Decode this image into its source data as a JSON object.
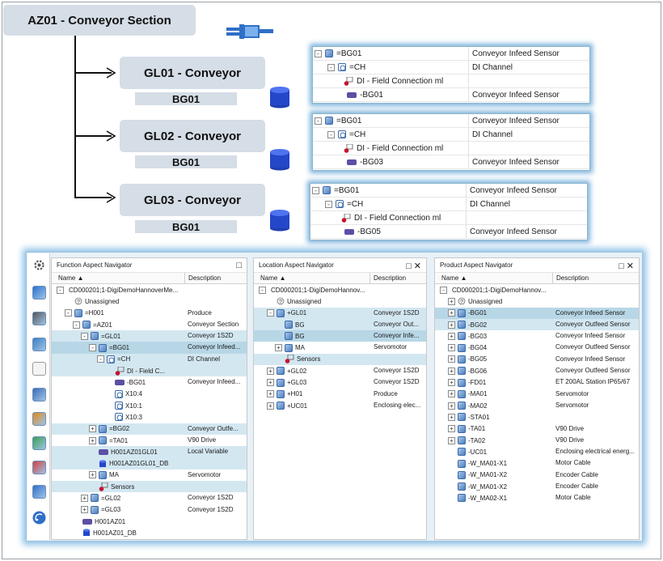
{
  "diagram": {
    "root_label": "AZ01 - Conveyor Section",
    "groups": [
      {
        "label": "GL01 - Conveyor",
        "sub": "BG01",
        "tree": [
          {
            "name": "=BG01",
            "desc": "Conveyor Infeed Sensor"
          },
          {
            "name": "=CH",
            "desc": "DI Channel"
          },
          {
            "name": "DI - Field Connection ml",
            "desc": ""
          },
          {
            "name": "-BG01",
            "desc": "Conveyor Infeed Sensor"
          }
        ]
      },
      {
        "label": "GL02 - Conveyor",
        "sub": "BG01",
        "tree": [
          {
            "name": "=BG01",
            "desc": "Conveyor Infeed Sensor"
          },
          {
            "name": "=CH",
            "desc": "DI Channel"
          },
          {
            "name": "DI - Field Connection ml",
            "desc": ""
          },
          {
            "name": "-BG03",
            "desc": "Conveyor Infeed Sensor"
          }
        ]
      },
      {
        "label": "GL03 - Conveyor",
        "sub": "BG01",
        "tree": [
          {
            "name": "=BG01",
            "desc": "Conveyor Infeed Sensor"
          },
          {
            "name": "=CH",
            "desc": "DI Channel"
          },
          {
            "name": "DI - Field Connection ml",
            "desc": ""
          },
          {
            "name": "-BG05",
            "desc": "Conveyor Infeed Sensor"
          }
        ]
      }
    ]
  },
  "function_nav": {
    "title": "Function Aspect Navigator",
    "col_name": "Name",
    "col_desc": "Description",
    "rows": [
      {
        "t": "CD000201;1-DigiDemoHannoverMe...",
        "d": "",
        "lvl": 0,
        "exp": "-",
        "ic": ""
      },
      {
        "t": "Unassigned",
        "d": "",
        "lvl": 1,
        "exp": "",
        "ic": "un"
      },
      {
        "t": "=H001",
        "d": "Produce",
        "lvl": 1,
        "exp": "-",
        "ic": "cube"
      },
      {
        "t": "=AZ01",
        "d": "Conveyor Section",
        "lvl": 2,
        "exp": "-",
        "ic": "cube"
      },
      {
        "t": "=GL01",
        "d": "Conveyor 1S2D",
        "lvl": 3,
        "exp": "-",
        "ic": "cube",
        "sel": 1
      },
      {
        "t": "=BG01",
        "d": "Conveyor Infeed...",
        "lvl": 4,
        "exp": "-",
        "ic": "cube",
        "sel": 2
      },
      {
        "t": "=CH",
        "d": "DI Channel",
        "lvl": 5,
        "exp": "-",
        "ic": "chn",
        "sel": 1
      },
      {
        "t": "DI - Field C...",
        "d": "",
        "lvl": 6,
        "exp": "",
        "ic": "sensor",
        "sel": 1
      },
      {
        "t": "-BG01",
        "d": "Conveyor Infeed...",
        "lvl": 6,
        "exp": "",
        "ic": "tag"
      },
      {
        "t": "X10:4",
        "d": "",
        "lvl": 6,
        "exp": "",
        "ic": "chn"
      },
      {
        "t": "X10:1",
        "d": "",
        "lvl": 6,
        "exp": "",
        "ic": "chn"
      },
      {
        "t": "X10:3",
        "d": "",
        "lvl": 6,
        "exp": "",
        "ic": "chn"
      },
      {
        "t": "=BG02",
        "d": "Conveyor Outfe...",
        "lvl": 4,
        "exp": "+",
        "ic": "cube",
        "sel": 1
      },
      {
        "t": "=TA01",
        "d": "V90 Drive",
        "lvl": 4,
        "exp": "+",
        "ic": "cube"
      },
      {
        "t": "H001AZ01GL01",
        "d": "Local Variable",
        "lvl": 4,
        "exp": "",
        "ic": "tag",
        "sel": 1
      },
      {
        "t": "H001AZ01GL01_DB",
        "d": "",
        "lvl": 4,
        "exp": "",
        "ic": "db",
        "sel": 1
      },
      {
        "t": "MA",
        "d": "Servomotor",
        "lvl": 4,
        "exp": "+",
        "ic": "cube"
      },
      {
        "t": "Sensors",
        "d": "",
        "lvl": 4,
        "exp": "",
        "ic": "sensor",
        "sel": 1
      },
      {
        "t": "=GL02",
        "d": "Conveyor 1S2D",
        "lvl": 3,
        "exp": "+",
        "ic": "cube"
      },
      {
        "t": "=GL03",
        "d": "Conveyor 1S2D",
        "lvl": 3,
        "exp": "+",
        "ic": "cube"
      },
      {
        "t": "H001AZ01",
        "d": "",
        "lvl": 2,
        "exp": "",
        "ic": "tag"
      },
      {
        "t": "H001AZ01_DB",
        "d": "",
        "lvl": 2,
        "exp": "",
        "ic": "db"
      }
    ]
  },
  "location_nav": {
    "title": "Location Aspect Navigator",
    "col_name": "Name",
    "col_desc": "Description",
    "rows": [
      {
        "t": "CD000201;1-DigiDemoHannov...",
        "d": "",
        "lvl": 0,
        "exp": "-",
        "ic": ""
      },
      {
        "t": "Unassigned",
        "d": "",
        "lvl": 1,
        "exp": "",
        "ic": "un"
      },
      {
        "t": "+GL01",
        "d": "Conveyor 1S2D",
        "lvl": 1,
        "exp": "-",
        "ic": "cube",
        "sel": 1
      },
      {
        "t": "BG",
        "d": "Conveyor Out...",
        "lvl": 2,
        "exp": "",
        "ic": "cube",
        "sel": 1
      },
      {
        "t": "BG",
        "d": "Conveyor Infe...",
        "lvl": 2,
        "exp": "",
        "ic": "cube",
        "sel": 2
      },
      {
        "t": "MA",
        "d": "Servomotor",
        "lvl": 2,
        "exp": "+",
        "ic": "cube"
      },
      {
        "t": "Sensors",
        "d": "",
        "lvl": 2,
        "exp": "",
        "ic": "sensor",
        "sel": 1
      },
      {
        "t": "+GL02",
        "d": "Conveyor 1S2D",
        "lvl": 1,
        "exp": "+",
        "ic": "cube"
      },
      {
        "t": "+GL03",
        "d": "Conveyor 1S2D",
        "lvl": 1,
        "exp": "+",
        "ic": "cube"
      },
      {
        "t": "+H01",
        "d": "Produce",
        "lvl": 1,
        "exp": "+",
        "ic": "cube"
      },
      {
        "t": "+UC01",
        "d": "Enclosing elec...",
        "lvl": 1,
        "exp": "+",
        "ic": "cube"
      }
    ]
  },
  "product_nav": {
    "title": "Product Aspect Navigator",
    "col_name": "Name",
    "col_desc": "Description",
    "rows": [
      {
        "t": "CD000201;1-DigiDemoHannov...",
        "d": "",
        "lvl": 0,
        "exp": "-",
        "ic": ""
      },
      {
        "t": "Unassigned",
        "d": "",
        "lvl": 1,
        "exp": "+",
        "ic": "un"
      },
      {
        "t": "-BG01",
        "d": "Conveyor Infeed Sensor",
        "lvl": 1,
        "exp": "+",
        "ic": "cube",
        "sel": 2
      },
      {
        "t": "-BG02",
        "d": "Conveyor Outfeed Sensor",
        "lvl": 1,
        "exp": "+",
        "ic": "cube",
        "sel": 1
      },
      {
        "t": "-BG03",
        "d": "Conveyor Infeed Sensor",
        "lvl": 1,
        "exp": "+",
        "ic": "cube"
      },
      {
        "t": "-BG04",
        "d": "Conveyor Outfeed Sensor",
        "lvl": 1,
        "exp": "+",
        "ic": "cube"
      },
      {
        "t": "-BG05",
        "d": "Conveyor Infeed Sensor",
        "lvl": 1,
        "exp": "+",
        "ic": "cube"
      },
      {
        "t": "-BG06",
        "d": "Conveyor Outfeed Sensor",
        "lvl": 1,
        "exp": "+",
        "ic": "cube"
      },
      {
        "t": "-FD01",
        "d": "ET 200AL Station IP65/67",
        "lvl": 1,
        "exp": "+",
        "ic": "cube"
      },
      {
        "t": "-MA01",
        "d": "Servomotor",
        "lvl": 1,
        "exp": "+",
        "ic": "cube"
      },
      {
        "t": "-MA02",
        "d": "Servomotor",
        "lvl": 1,
        "exp": "+",
        "ic": "cube"
      },
      {
        "t": "-STA01",
        "d": "",
        "lvl": 1,
        "exp": "+",
        "ic": "cube"
      },
      {
        "t": "-TA01",
        "d": "V90 Drive",
        "lvl": 1,
        "exp": "+",
        "ic": "cube"
      },
      {
        "t": "-TA02",
        "d": "V90 Drive",
        "lvl": 1,
        "exp": "+",
        "ic": "cube"
      },
      {
        "t": "-UC01",
        "d": "Enclosing electrical energ...",
        "lvl": 1,
        "exp": "",
        "ic": "cube"
      },
      {
        "t": "-W_MA01-X1",
        "d": "Motor Cable",
        "lvl": 1,
        "exp": "",
        "ic": "cube"
      },
      {
        "t": "-W_MA01-X2",
        "d": "Encoder Cable",
        "lvl": 1,
        "exp": "",
        "ic": "cube"
      },
      {
        "t": "-W_MA01-X2",
        "d": "Encoder Cable",
        "lvl": 1,
        "exp": "",
        "ic": "cube"
      },
      {
        "t": "-W_MA02-X1",
        "d": "Motor Cable",
        "lvl": 1,
        "exp": "",
        "ic": "cube"
      }
    ]
  },
  "sidebar_icons": [
    "gear-icon",
    "network-icon",
    "wrench-icon",
    "device-icon",
    "blank-icon",
    "globe-icon",
    "tree-icon",
    "hierarchy-icon",
    "library-icon",
    "tools-icon",
    "wireless-icon"
  ]
}
